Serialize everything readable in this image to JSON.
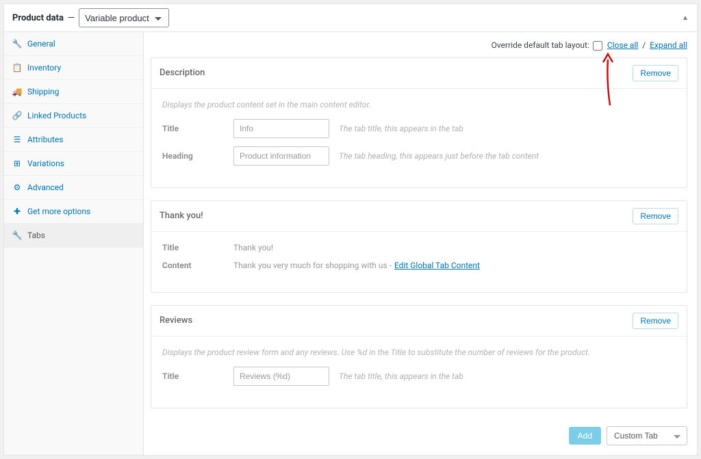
{
  "header": {
    "title": "Product data",
    "product_type": "Variable product"
  },
  "sidebar": {
    "items": [
      {
        "label": "General",
        "icon": "wrench"
      },
      {
        "label": "Inventory",
        "icon": "clipboard"
      },
      {
        "label": "Shipping",
        "icon": "truck"
      },
      {
        "label": "Linked Products",
        "icon": "link"
      },
      {
        "label": "Attributes",
        "icon": "list"
      },
      {
        "label": "Variations",
        "icon": "grid"
      },
      {
        "label": "Advanced",
        "icon": "gear"
      },
      {
        "label": "Get more options",
        "icon": "plus"
      },
      {
        "label": "Tabs",
        "icon": "wrench",
        "active": true
      }
    ]
  },
  "controls": {
    "override_label": "Override default tab layout:",
    "close_all": "Close all",
    "expand_all": "Expand all",
    "separator": "/",
    "remove": "Remove",
    "add": "Add",
    "add_select": "Custom Tab"
  },
  "tabs": {
    "description": {
      "title": "Description",
      "help": "Displays the product content set in the main content editor.",
      "title_label": "Title",
      "title_placeholder": "Info",
      "title_hint": "The tab title, this appears in the tab",
      "heading_label": "Heading",
      "heading_placeholder": "Product information",
      "heading_hint": "The tab heading, this appears just before the tab content"
    },
    "thankyou": {
      "title": "Thank you!",
      "title_label": "Title",
      "title_value": "Thank you!",
      "content_label": "Content",
      "content_value": "Thank you very much for shopping with us - ",
      "content_link": "Edit Global Tab Content"
    },
    "reviews": {
      "title": "Reviews",
      "help": "Displays the product review form and any reviews. Use %d in the Title to substitute the number of reviews for the product.",
      "title_label": "Title",
      "title_placeholder": "Reviews (%d)",
      "title_hint": "The tab title, this appears in the tab"
    }
  }
}
